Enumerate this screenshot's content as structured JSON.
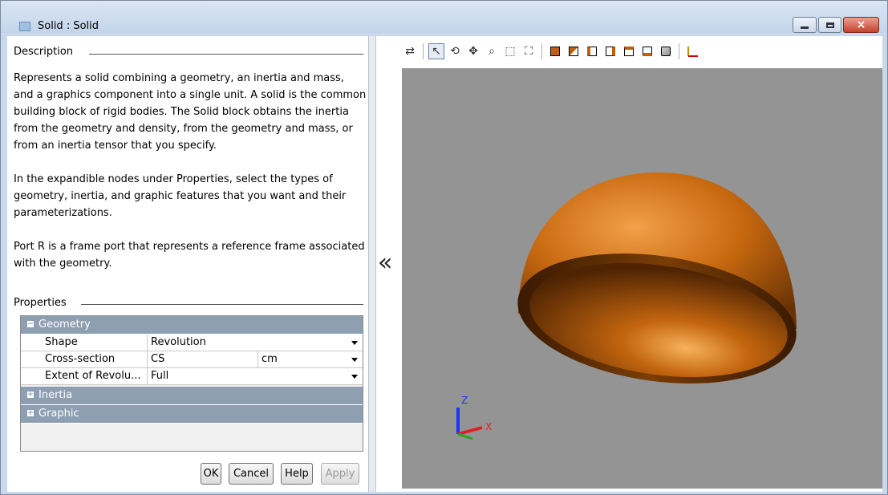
{
  "window": {
    "title": "Solid : Solid",
    "close_glyph": "×"
  },
  "description": {
    "group_label": "Description",
    "paragraphs": [
      "Represents a solid combining a geometry, an inertia and mass, and a graphics component into a single unit. A solid is the common building block of rigid bodies. The Solid block obtains the inertia from the geometry and density, from the geometry and mass, or from an inertia tensor that you specify.",
      "In the expandible nodes under Properties, select the types of geometry, inertia, and graphic features that you want and their parameterizations.",
      "Port R is a frame port that represents a reference frame associated with the geometry."
    ]
  },
  "properties": {
    "group_label": "Properties",
    "geometry": {
      "label": "Geometry",
      "expand_glyph": "−",
      "rows": [
        {
          "name": "Shape",
          "value": "Revolution",
          "unit": ""
        },
        {
          "name": "Cross-section",
          "value": "CS",
          "unit": "cm"
        },
        {
          "name": "Extent of Revolu...",
          "value": "Full",
          "unit": ""
        }
      ]
    },
    "inertia": {
      "label": "Inertia",
      "expand_glyph": "+"
    },
    "graphic": {
      "label": "Graphic",
      "expand_glyph": "+"
    }
  },
  "buttons": {
    "ok": "OK",
    "cancel": "Cancel",
    "help": "Help",
    "apply": "Apply"
  },
  "splitter": {
    "collapse_glyph": "«"
  },
  "toolbar": {
    "icons": [
      "swap-icon",
      "select-pointer-icon",
      "rotate-icon",
      "pan-icon",
      "zoom-icon",
      "zoom-box-icon",
      "fit-to-view-icon",
      "front-view-icon",
      "back-view-icon",
      "left-view-icon",
      "right-view-icon",
      "top-view-icon",
      "bottom-view-icon",
      "isometric-view-icon",
      "axes-triad-icon"
    ]
  },
  "viewport": {
    "background": "#949494",
    "solid_color": "#d77a12",
    "triad": {
      "z_label": "Z",
      "x_label": "X"
    }
  }
}
